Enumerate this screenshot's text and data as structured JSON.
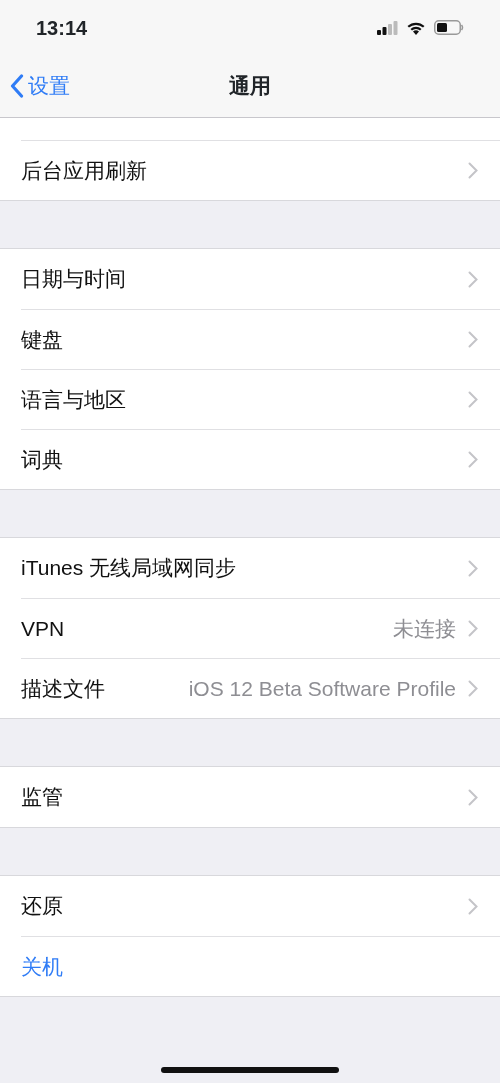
{
  "status_bar": {
    "time": "13:14"
  },
  "nav_bar": {
    "back": "设置",
    "title": "通用"
  },
  "groups": [
    {
      "rows": [
        {
          "kind": "nav",
          "label": "后台应用刷新"
        }
      ]
    },
    {
      "rows": [
        {
          "kind": "nav",
          "label": "日期与时间"
        },
        {
          "kind": "nav",
          "label": "键盘"
        },
        {
          "kind": "nav",
          "label": "语言与地区"
        },
        {
          "kind": "nav",
          "label": "词典"
        }
      ]
    },
    {
      "rows": [
        {
          "kind": "nav",
          "label": "iTunes 无线局域网同步"
        },
        {
          "kind": "nav",
          "label": "VPN",
          "value": "未连接"
        },
        {
          "kind": "nav",
          "label": "描述文件",
          "value": "iOS 12 Beta Software Profile"
        }
      ]
    },
    {
      "rows": [
        {
          "kind": "nav",
          "label": "监管"
        }
      ]
    },
    {
      "rows": [
        {
          "kind": "nav",
          "label": "还原"
        },
        {
          "kind": "action",
          "label": "关机"
        }
      ]
    }
  ]
}
